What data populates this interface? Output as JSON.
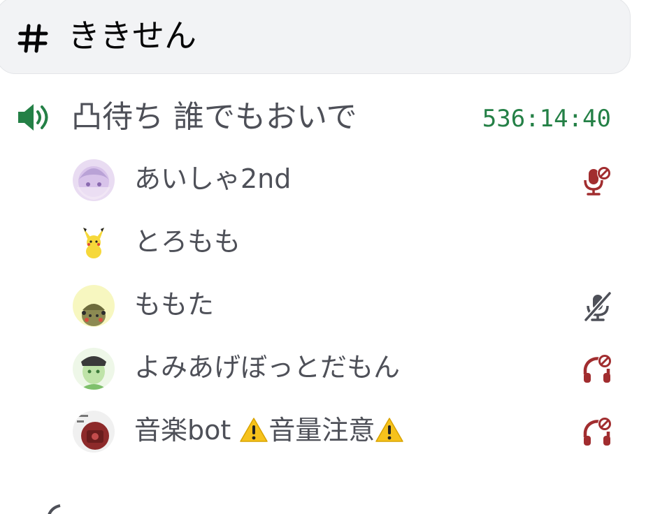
{
  "text_channel": {
    "name": "ききせん",
    "icon": "hash-icon"
  },
  "voice_channel": {
    "name": "凸待ち 誰でもおいで",
    "timer": "536:14:40",
    "icon": "speaker-icon",
    "accent": "#248046"
  },
  "members": [
    {
      "name": "あいしゃ2nd",
      "status": "server-mic-muted-icon"
    },
    {
      "name": "とろもも",
      "status": ""
    },
    {
      "name": "ももた",
      "status": "self-mic-muted-icon"
    },
    {
      "name": "よみあげぼっとだもん",
      "status": "server-deafened-icon"
    },
    {
      "name_parts": [
        "音楽bot",
        "音量注意"
      ],
      "status": "server-deafened-icon"
    }
  ],
  "colors": {
    "server_muted": "#a12d2f",
    "self_muted": "#4e5058"
  }
}
